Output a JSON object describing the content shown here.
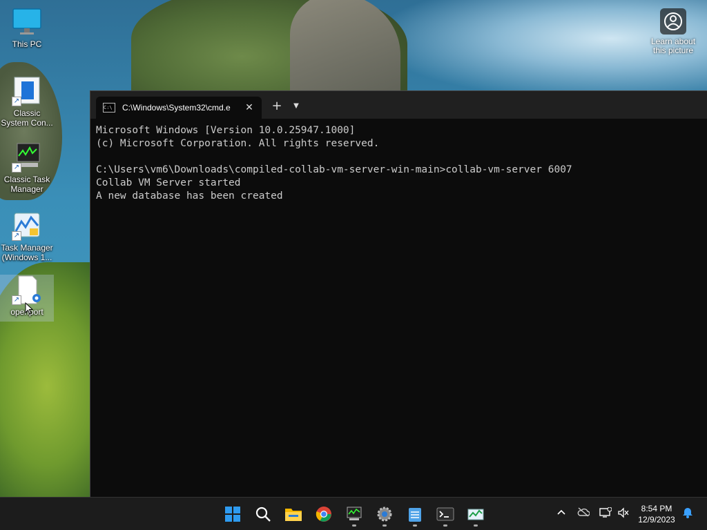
{
  "desktop": {
    "icons": [
      {
        "label": "This PC",
        "icon": "monitor-icon"
      },
      {
        "label": "Classic System Con...",
        "icon": "control-panel-icon"
      },
      {
        "label": "Classic Task Manager",
        "icon": "task-manager-icon"
      },
      {
        "label": "Task Manager (Windows 1...",
        "icon": "task-manager-modern-icon"
      },
      {
        "label": "openport",
        "icon": "file-icon"
      }
    ],
    "learn_about": "Learn about this picture"
  },
  "terminal": {
    "tab_title": "C:\\Windows\\System32\\cmd.e",
    "new_tab": "+",
    "console_lines": [
      "Microsoft Windows [Version 10.0.25947.1000]",
      "(c) Microsoft Corporation. All rights reserved.",
      "",
      "C:\\Users\\vm6\\Downloads\\compiled-collab-vm-server-win-main>collab-vm-server 6007",
      "Collab VM Server started",
      "A new database has been created"
    ]
  },
  "taskbar": {
    "apps": [
      "start-icon",
      "search-icon",
      "file-explorer-icon",
      "chrome-icon",
      "task-manager-icon",
      "settings-icon",
      "notepad-icon",
      "terminal-icon",
      "resource-monitor-icon"
    ],
    "time": "8:54 PM",
    "date": "12/9/2023"
  }
}
